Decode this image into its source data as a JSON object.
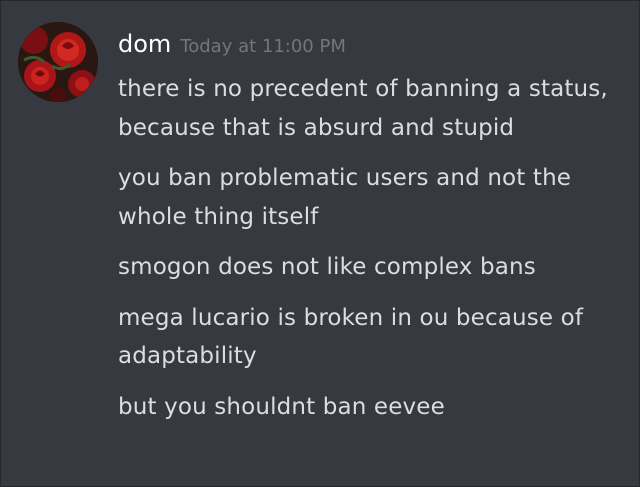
{
  "message_group": {
    "author": "dom",
    "timestamp": "Today at 11:00 PM",
    "messages": [
      "there is no precedent of banning a status, because that is absurd and stupid",
      "you ban problematic users and not the whole thing itself",
      "smogon does not like complex bans",
      "mega lucario is broken in ou because of adaptability",
      "but you shouldnt ban eevee"
    ]
  },
  "colors": {
    "background": "#36393f",
    "username": "#ffffff",
    "timestamp": "#72767d",
    "message_text": "#dcddde"
  }
}
